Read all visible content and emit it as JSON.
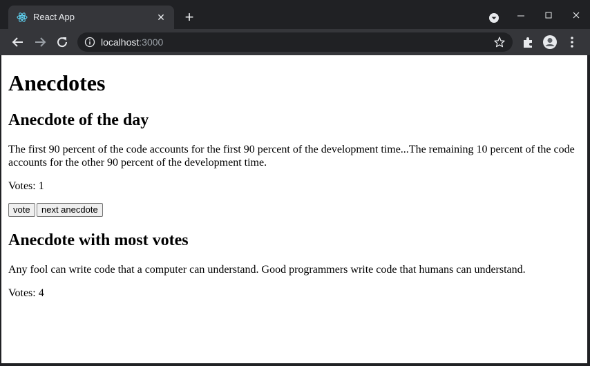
{
  "browser": {
    "tab_title": "React App",
    "url_host": "localhost",
    "url_port": ":3000"
  },
  "page": {
    "heading": "Anecdotes",
    "daily": {
      "heading": "Anecdote of the day",
      "text": "The first 90 percent of the code accounts for the first 90 percent of the development time...The remaining 10 percent of the code accounts for the other 90 percent of the development time.",
      "votes": "Votes: 1"
    },
    "buttons": {
      "vote": "vote",
      "next": "next anecdote"
    },
    "top": {
      "heading": "Anecdote with most votes",
      "text": "Any fool can write code that a computer can understand. Good programmers write code that humans can understand.",
      "votes": "Votes: 4"
    }
  }
}
